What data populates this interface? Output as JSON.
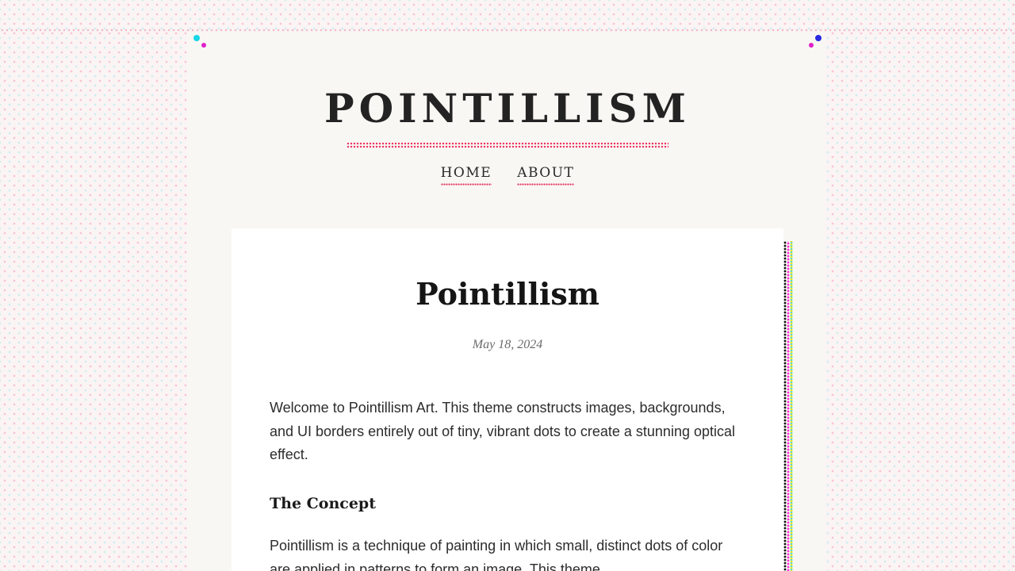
{
  "site": {
    "title": "POINTILLISM"
  },
  "nav": {
    "items": [
      {
        "label": "HOME"
      },
      {
        "label": "ABOUT"
      }
    ]
  },
  "post": {
    "title": "Pointillism",
    "date": "May 18, 2024",
    "intro": "Welcome to Pointillism Art. This theme constructs images, backgrounds, and UI borders entirely out of tiny, vibrant dots to create a stunning optical effect.",
    "section_heading": "The Concept",
    "section_text": "Pointillism is a technique of painting in which small, distinct dots of color are applied in patterns to form an image. This theme"
  },
  "colors": {
    "accent": "#e0325f",
    "corner_cyan": "#19d6e6",
    "corner_magenta": "#e020c8",
    "corner_blue": "#2a2ae0",
    "text": "#232323"
  }
}
